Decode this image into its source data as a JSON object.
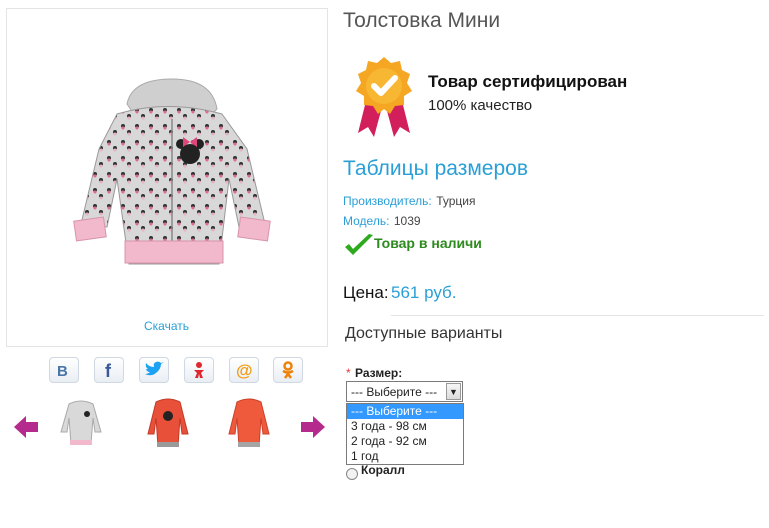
{
  "product": {
    "title": "Толстовка Мини",
    "download_label": "Скачать"
  },
  "certificate": {
    "title": "Товар сертифицирован",
    "subtitle": "100% качество",
    "icon": "certificate-badge-icon",
    "color": "#f5a623"
  },
  "size_table_link": "Таблицы размеров",
  "meta": {
    "manufacturer_label": "Производитель:",
    "manufacturer_value": "Турция",
    "model_label": "Модель:",
    "model_value": "1039"
  },
  "stock": {
    "text": "Товар в наличи",
    "color": "#2d8a1e"
  },
  "price": {
    "label": "Цена:",
    "value": "561 руб."
  },
  "options": {
    "title": "Доступные варианты",
    "size_required_mark": "*",
    "size_label": "Размер:",
    "selected": "--- Выберите ---",
    "dropdown": [
      "--- Выберите ---",
      "3 года - 98 см",
      "2 года - 92 см",
      "1 год"
    ],
    "radio_label": "Коралл"
  },
  "share": [
    {
      "name": "vk-icon",
      "glyph": "В",
      "color": "#4a76a8"
    },
    {
      "name": "facebook-icon",
      "glyph": "f",
      "color": "#3b5998"
    },
    {
      "name": "twitter-icon",
      "glyph": "🐦",
      "color": "#1da1f2"
    },
    {
      "name": "moimir-icon",
      "glyph": "Я",
      "color": "#e0262e"
    },
    {
      "name": "mailru-icon",
      "glyph": "@",
      "color": "#f39c12"
    },
    {
      "name": "odnoklassniki-icon",
      "glyph": "ок",
      "color": "#ee8208"
    }
  ],
  "colors": {
    "accent": "#2a9fd6",
    "thumb_arrows": "#b52b8d"
  }
}
